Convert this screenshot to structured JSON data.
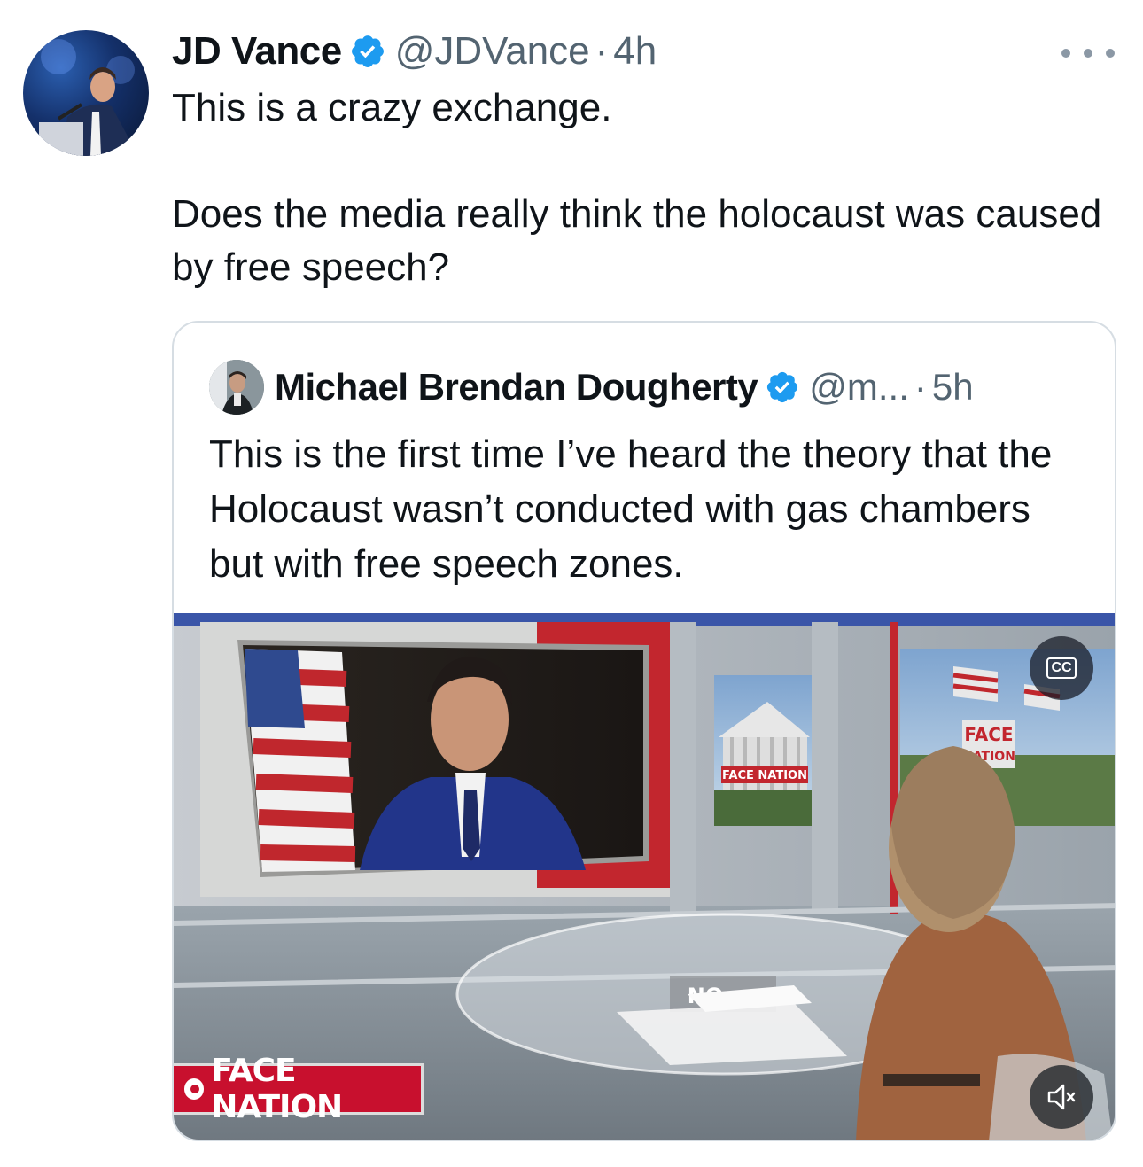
{
  "tweet": {
    "author_name": "JD Vance",
    "handle": "@JDVance",
    "separator": "·",
    "time": "4h",
    "text": "This is a crazy exchange.\n\nDoes the media really think the holocaust was caused by free speech?"
  },
  "quoted": {
    "author_name": "Michael Brendan Dougherty",
    "handle": "@m...",
    "separator": "·",
    "time": "5h",
    "text": "This is the first time I’ve heard the theory that the Holocaust wasn’t conducted with gas chambers but with free speech zones."
  },
  "video": {
    "cc_label": "CC",
    "logo_text": "FACE NATION",
    "screen_logo_text": "FACE NATION",
    "set_logo_line1": "FACE",
    "set_logo_line2": "NATION",
    "desk_text": "NO"
  },
  "colors": {
    "verified_blue": "#1d9bf0",
    "secondary_text": "#536471",
    "cbs_red": "#c8102e"
  },
  "icons": [
    "more-icon",
    "verified-badge-icon",
    "cc-icon",
    "mute-icon"
  ]
}
